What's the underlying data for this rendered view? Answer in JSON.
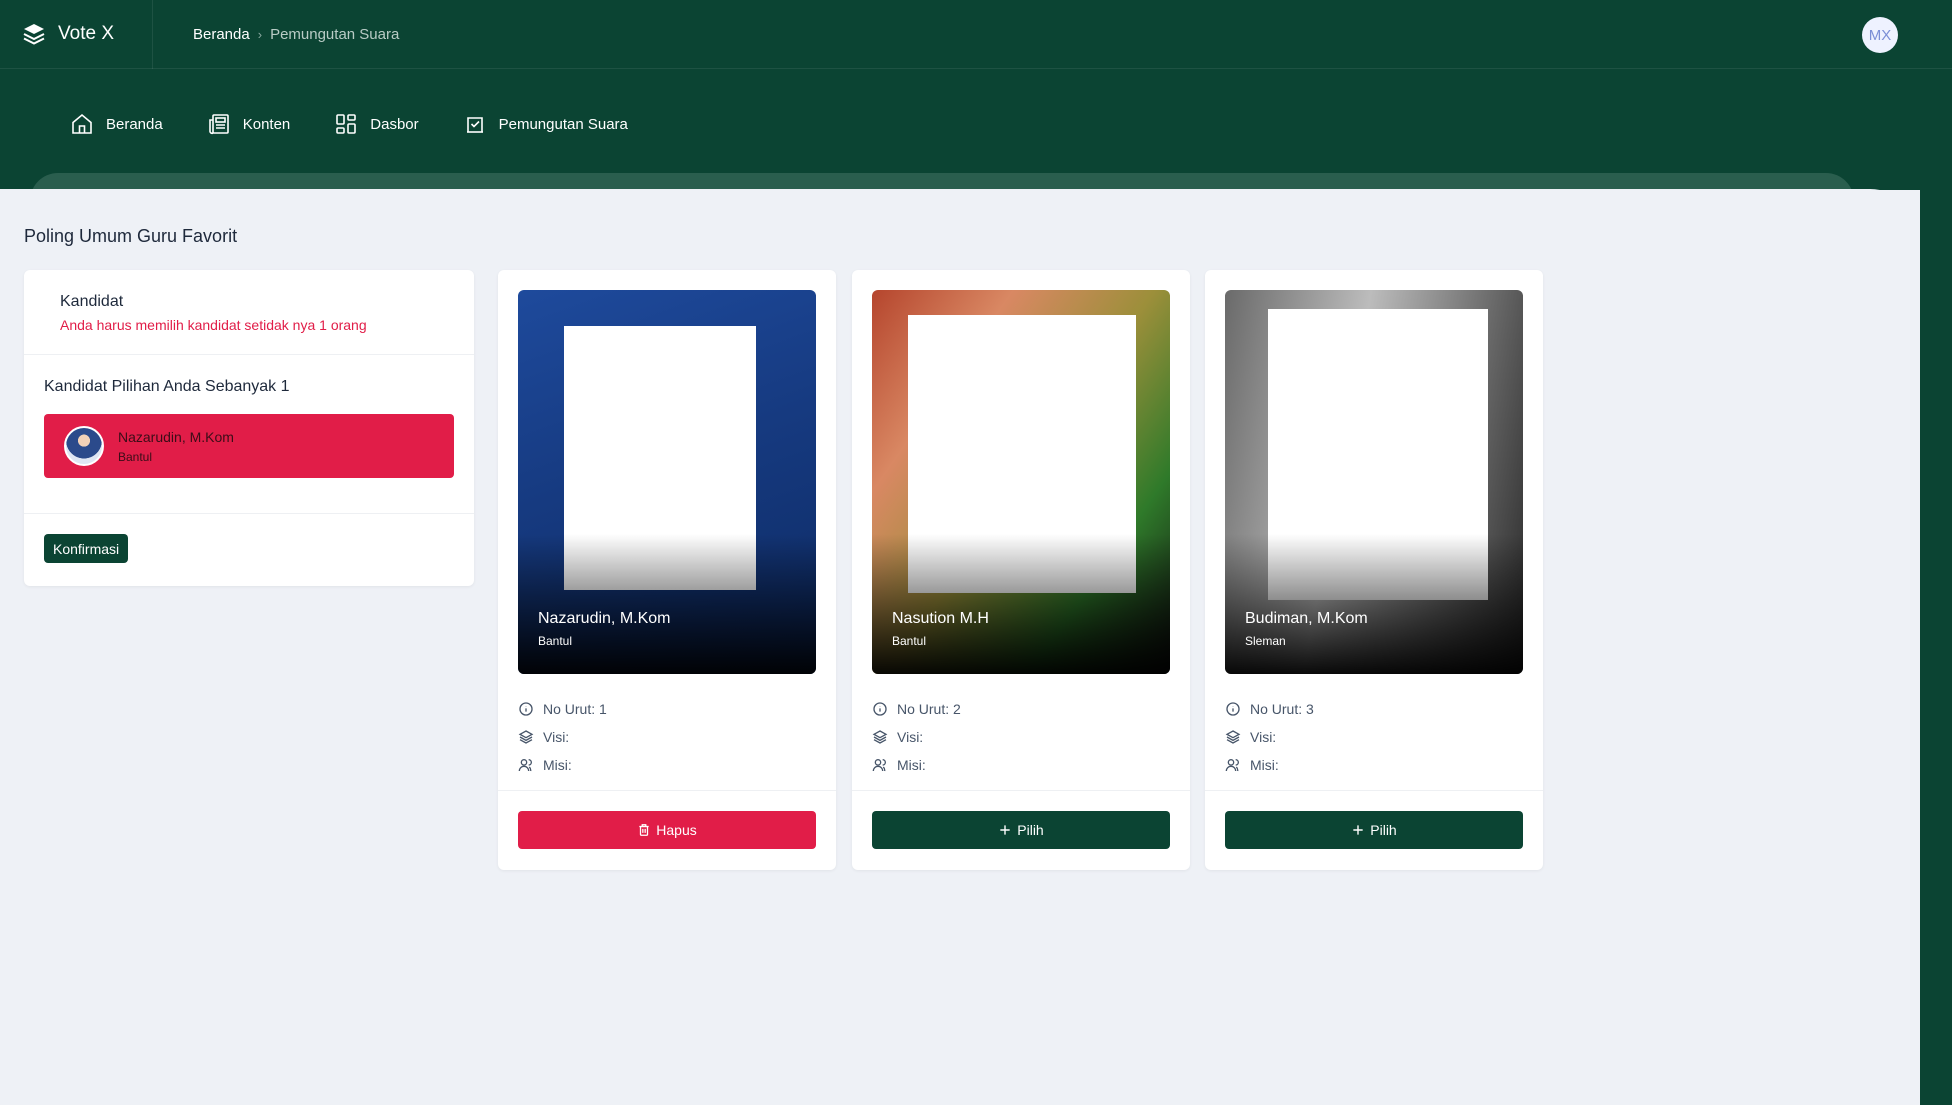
{
  "app": {
    "name": "Vote X",
    "avatar_initials": "MX"
  },
  "breadcrumb": {
    "home": "Beranda",
    "separator": "›",
    "current": "Pemungutan Suara"
  },
  "nav": [
    {
      "label": "Beranda",
      "icon": "home-icon"
    },
    {
      "label": "Konten",
      "icon": "newspaper-icon"
    },
    {
      "label": "Dasbor",
      "icon": "dashboard-icon"
    },
    {
      "label": "Pemungutan Suara",
      "icon": "vote-icon"
    }
  ],
  "page": {
    "title": "Poling Umum Guru Favorit"
  },
  "sidebar": {
    "title": "Kandidat",
    "warning": "Anda harus memilih kandidat setidak nya 1 orang",
    "selection_title": "Kandidat Pilihan Anda Sebanyak 1",
    "selected": {
      "name": "Nazarudin, M.Kom",
      "region": "Bantul"
    },
    "confirm_label": "Konfirmasi"
  },
  "candidates": [
    {
      "name": "Nazarudin, M.Kom",
      "region": "Bantul",
      "no_urut": "No Urut: 1",
      "visi": "Visi:",
      "misi": "Misi:",
      "action": "Hapus"
    },
    {
      "name": "Nasution M.H",
      "region": "Bantul",
      "no_urut": "No Urut: 2",
      "visi": "Visi:",
      "misi": "Misi:",
      "action": "Pilih"
    },
    {
      "name": "Budiman, M.Kom",
      "region": "Sleman",
      "no_urut": "No Urut: 3",
      "visi": "Visi:",
      "misi": "Misi:",
      "action": "Pilih"
    }
  ],
  "colors": {
    "primary": "#0b4433",
    "danger": "#e11d48",
    "background": "#eef1f6"
  }
}
